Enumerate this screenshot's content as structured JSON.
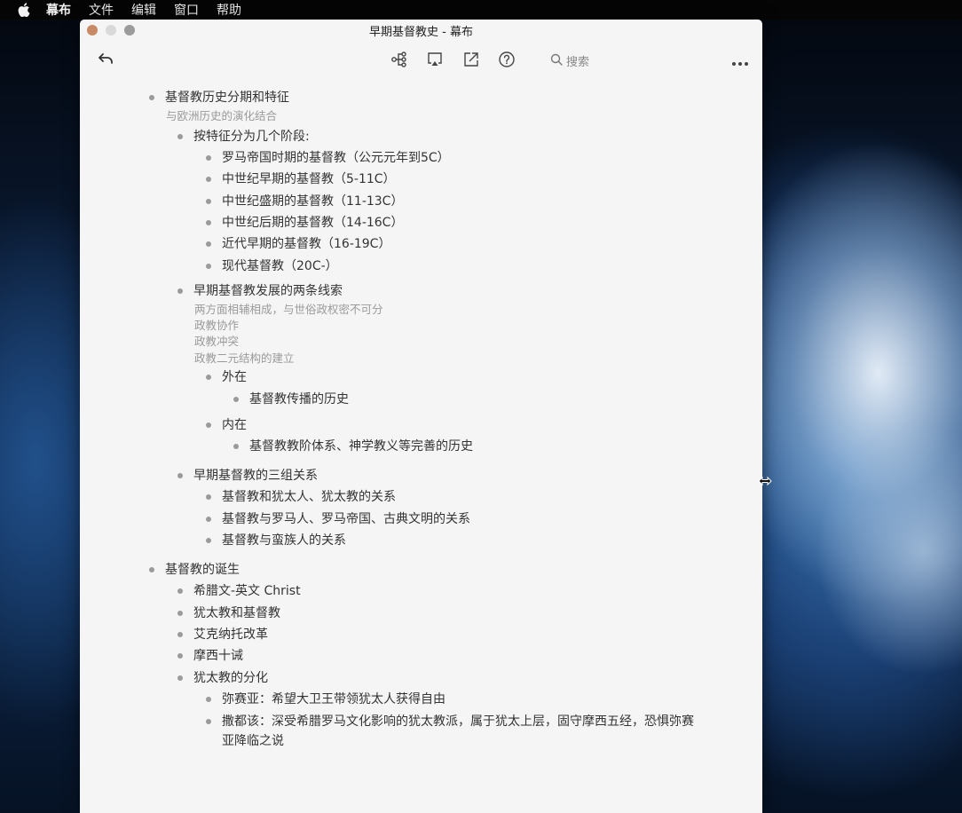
{
  "menubar": {
    "items": [
      "幕布",
      "文件",
      "编辑",
      "窗口",
      "帮助"
    ]
  },
  "window": {
    "title": "早期基督教史 - 幕布"
  },
  "toolbar": {
    "search_label": "搜索",
    "icons": [
      "undo-icon",
      "mindmap-icon",
      "present-icon",
      "export-icon",
      "help-icon",
      "search-icon",
      "more-icon"
    ]
  },
  "outline": {
    "n1": "基督教历史分期和特征",
    "n1_note": "与欧洲历史的演化结合",
    "n1_1": "按特征分为几个阶段:",
    "n1_1_1": "罗马帝国时期的基督教（公元元年到5C）",
    "n1_1_2": "中世纪早期的基督教（5-11C）",
    "n1_1_3": "中世纪盛期的基督教（11-13C）",
    "n1_1_4": "中世纪后期的基督教（14-16C）",
    "n1_1_5": "近代早期的基督教（16-19C）",
    "n1_1_6": "现代基督教（20C-）",
    "n1_2": "早期基督教发展的两条线索",
    "n1_2_note1": "两方面相辅相成，与世俗政权密不可分",
    "n1_2_note2": "政教协作",
    "n1_2_note3": "政教冲突",
    "n1_2_note4": "政教二元结构的建立",
    "n1_2_1": "外在",
    "n1_2_1_1": "基督教传播的历史",
    "n1_2_2": "内在",
    "n1_2_2_1": "基督教教阶体系、神学教义等完善的历史",
    "n1_3": "早期基督教的三组关系",
    "n1_3_1": "基督教和犹太人、犹太教的关系",
    "n1_3_2": "基督教与罗马人、罗马帝国、古典文明的关系",
    "n1_3_3": "基督教与蛮族人的关系",
    "n2": "基督教的诞生",
    "n2_1": "希腊文-英文 Christ",
    "n2_2": "犹太教和基督教",
    "n2_3": "艾克纳托改革",
    "n2_4": "摩西十诫",
    "n2_5": "犹太教的分化",
    "n2_5_1": "弥赛亚：希望大卫王带领犹太人获得自由",
    "n2_5_2a": "撒都该：深受希腊罗马文化影响的犹太教派，属于犹太上层，固守摩西五经，恐惧弥赛",
    "n2_5_2b": "亚降临之说"
  }
}
